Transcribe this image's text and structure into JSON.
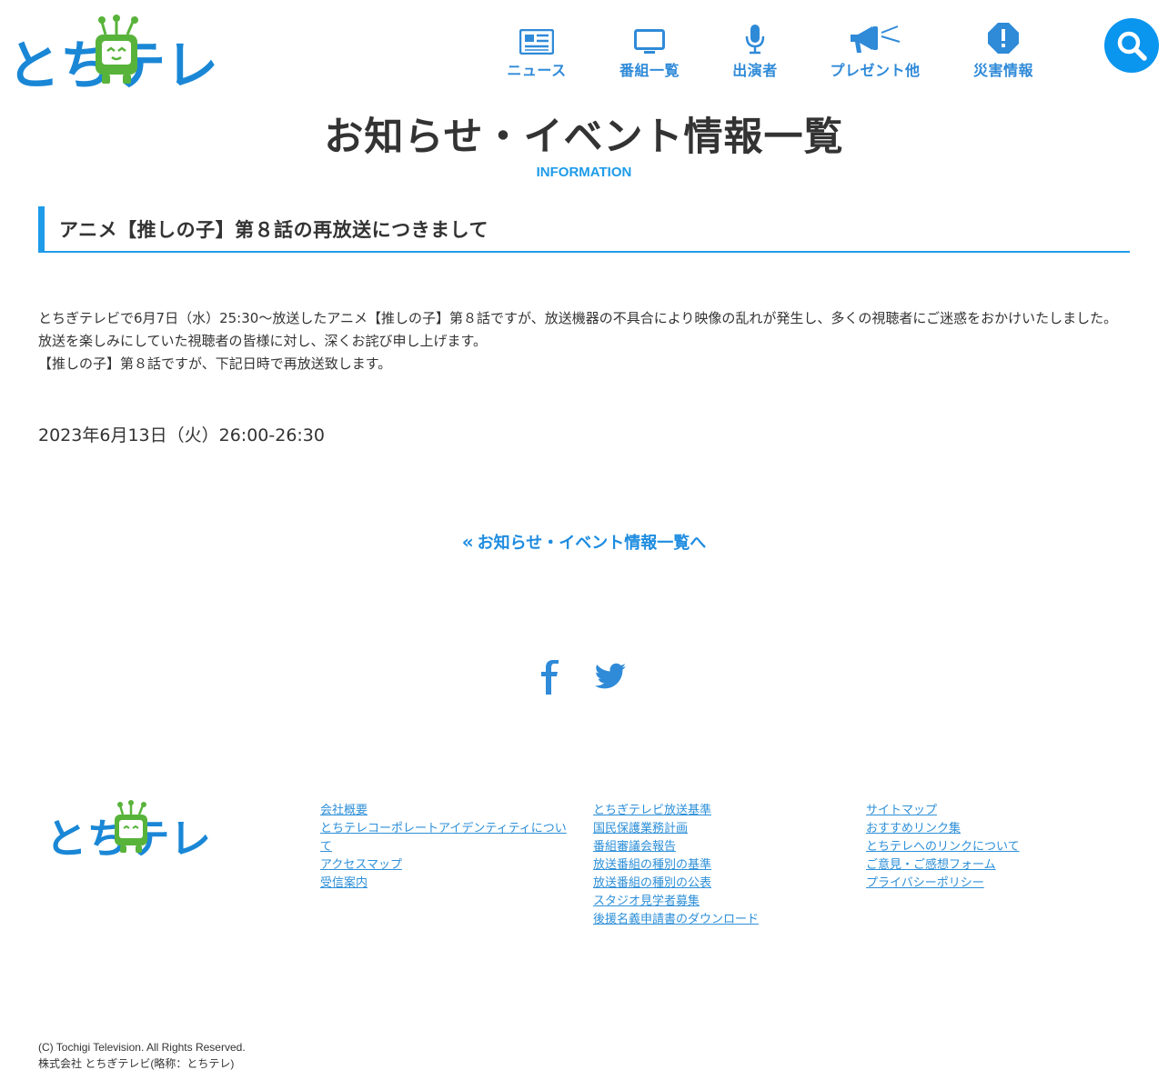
{
  "header": {
    "logo_text": "とちテレ",
    "nav": [
      {
        "label": "ニュース",
        "icon": "newspaper-icon"
      },
      {
        "label": "番組一覧",
        "icon": "tv-icon"
      },
      {
        "label": "出演者",
        "icon": "microphone-icon"
      },
      {
        "label": "プレゼント他",
        "icon": "megaphone-icon"
      },
      {
        "label": "災害情報",
        "icon": "alert-icon"
      }
    ],
    "search_icon": "search-icon"
  },
  "page": {
    "title": "お知らせ・イベント情報一覧",
    "subtitle": "INFORMATION"
  },
  "article": {
    "heading": "アニメ【推しの子】第８話の再放送につきまして",
    "paragraphs": [
      "とちぎテレビで6月7日（水）25:30～放送したアニメ【推しの子】第８話ですが、放送機器の不具合により映像の乱れが発生し、多くの視聴者にご迷惑をおかけいたしました。",
      "放送を楽しみにしていた視聴者の皆様に対し、深くお詫び申し上げます。",
      "【推しの子】第８話ですが、下記日時で再放送致します。"
    ],
    "rebroadcast": "2023年6月13日（火）26:00-26:30"
  },
  "back_link": {
    "label": "お知らせ・イベント情報一覧へ"
  },
  "social": {
    "facebook_icon": "facebook-icon",
    "twitter_icon": "twitter-icon"
  },
  "footer": {
    "columns": [
      [
        "会社概要",
        "とちテレコーポレートアイデンティティについて",
        "アクセスマップ",
        "受信案内"
      ],
      [
        "とちぎテレビ放送基準",
        "国民保護業務計画",
        "番組審議会報告",
        "放送番組の種別の基準",
        "放送番組の種別の公表",
        "スタジオ見学者募集",
        "後援名義申請書のダウンロード"
      ],
      [
        "サイトマップ",
        "おすすめリンク集",
        "とちテレへのリンクについて",
        "ご意見・ご感想フォーム",
        "プライバシーポリシー"
      ]
    ],
    "copyright_en": "(C) Tochigi Television. All Rights Reserved.",
    "copyright_ja": "株式会社 とちぎテレビ(略称：とちテレ)"
  },
  "colors": {
    "accent": "#1e9be9",
    "logo_blue": "#1a87d6",
    "logo_green": "#58b33a",
    "text": "#333333"
  }
}
